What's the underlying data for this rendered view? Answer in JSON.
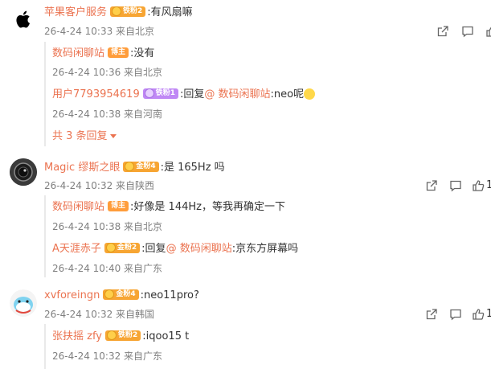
{
  "comments": [
    {
      "user": "苹果客户服务",
      "badge": "铁粉2",
      "text": ":有风扇嘛",
      "meta": "26-4-24 10:33 来自北京",
      "replies": [
        {
          "user": "数码闲聊站",
          "host_badge": "博主",
          "text": ":没有",
          "meta": "26-4-24 10:36 来自北京"
        },
        {
          "user": "用户7793954619",
          "badge": "铁粉1",
          "reply_prefix": ":回复",
          "mention": "@ 数码闲聊站",
          "text": ":neo呢",
          "meta": "26-4-24 10:38 来自河南"
        }
      ],
      "expand_label": "共 3 条回复"
    },
    {
      "user": "Magic 缪斯之眼",
      "badge": "金粉4",
      "text": ":是 165Hz 吗",
      "meta": "26-4-24 10:32 来自陕西",
      "like_count": "1",
      "replies": [
        {
          "user": "数码闲聊站",
          "host_badge": "博主",
          "text": ":好像是 144Hz，等我再确定一下",
          "meta": "26-4-24 10:38 来自北京"
        },
        {
          "user": "A天涯赤子",
          "badge": "金粉2",
          "reply_prefix": ":回复",
          "mention": "@ 数码闲聊站",
          "text": ":京东方屏幕吗",
          "meta": "26-4-24 10:40 来自广东"
        }
      ]
    },
    {
      "user": "xvforeingn",
      "badge": "金粉4",
      "text": ":neo11pro?",
      "meta": "26-4-24 10:32 来自韩国",
      "like_count": "1",
      "replies": [
        {
          "user": "张扶摇 zfy",
          "badge": "铁粉2",
          "text": ":iqoo15 t",
          "meta": "26-4-24 10:32 来自广东"
        }
      ]
    }
  ],
  "icons": {
    "share": "share-icon",
    "comment": "comment-icon",
    "like": "like-icon",
    "apple_logo": "apple-logo-icon"
  },
  "colors": {
    "username": "#eb7350",
    "meta": "#808080",
    "badge_gold": "#f7a533",
    "badge_purple": "#c088f5"
  }
}
